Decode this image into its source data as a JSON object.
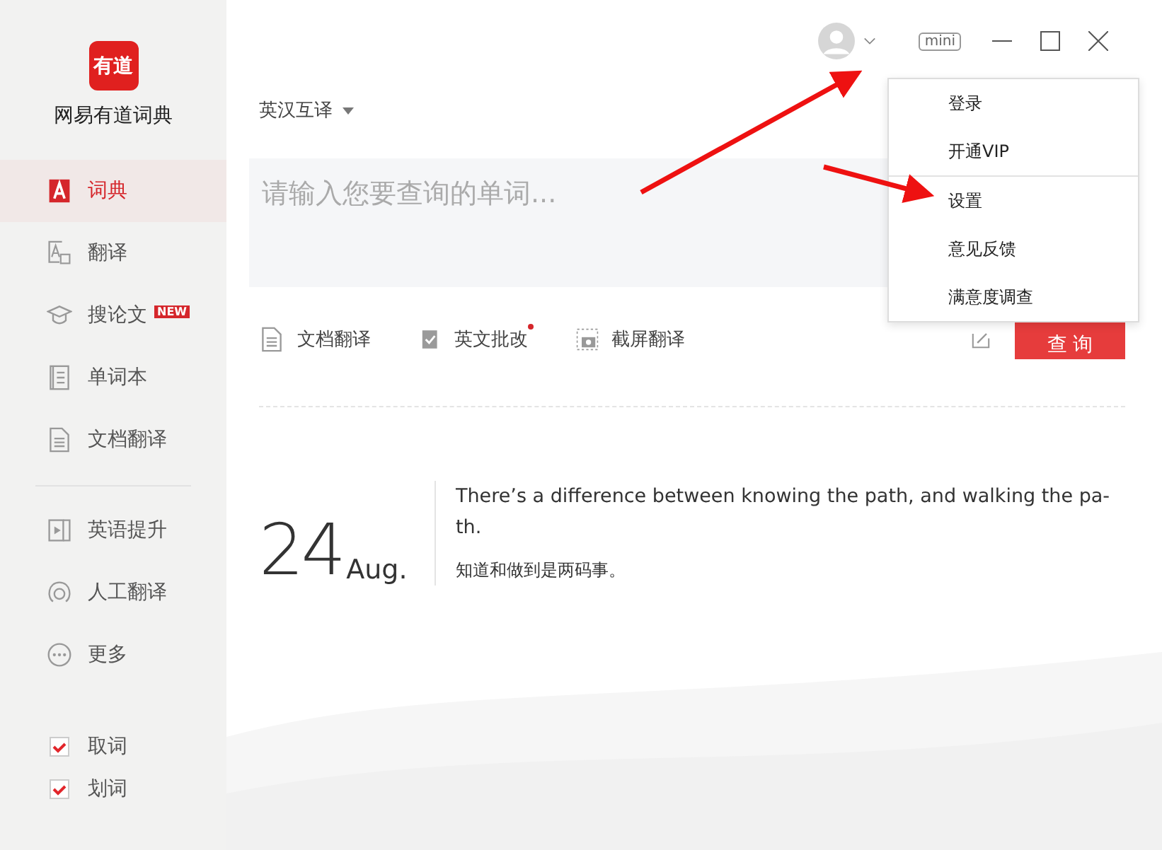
{
  "app": {
    "logo": "有道",
    "name": "网易有道词典"
  },
  "sidebar": {
    "items": [
      {
        "label": "词典",
        "selected": true
      },
      {
        "label": "翻译",
        "selected": false
      },
      {
        "label": "搜论文",
        "badge": "NEW",
        "selected": false
      },
      {
        "label": "单词本",
        "selected": false
      },
      {
        "label": "文档翻译",
        "selected": false
      }
    ],
    "items2": [
      {
        "label": "英语提升",
        "selected": false
      },
      {
        "label": "人工翻译",
        "selected": false
      },
      {
        "label": "更多",
        "selected": false
      }
    ],
    "checkboxes": [
      {
        "label": "取词",
        "checked": true
      },
      {
        "label": "划词",
        "checked": true
      }
    ]
  },
  "window_controls": {
    "mini": "mini"
  },
  "language": "英汉互译",
  "search": {
    "placeholder": "请输入您要查询的单词..."
  },
  "tools": [
    {
      "label": "文档翻译",
      "dot": false
    },
    {
      "label": "英文批改",
      "dot": true
    },
    {
      "label": "截屏翻译",
      "dot": false
    }
  ],
  "query_button": "查 询",
  "daily": {
    "day": "24",
    "month": "Aug.",
    "quote_lines": [
      "There’s a difference between knowing the path, and walking the pa-",
      "th."
    ],
    "translation": "知道和做到是两码事。"
  },
  "user_menu": {
    "items": [
      {
        "label": "登录",
        "divider_after": false
      },
      {
        "label": "开通VIP",
        "divider_after": true
      },
      {
        "label": "设置",
        "divider_after": false
      },
      {
        "label": "意见反馈",
        "divider_after": false
      },
      {
        "label": "满意度调查",
        "divider_after": false
      }
    ]
  }
}
